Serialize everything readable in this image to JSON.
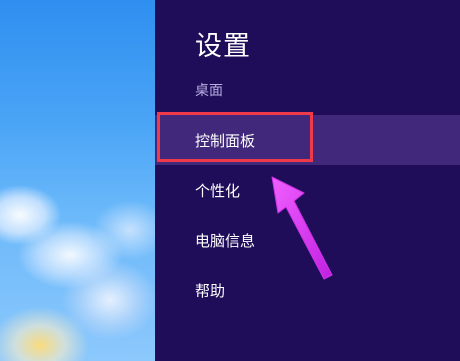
{
  "settings": {
    "title": "设置",
    "subtitle": "桌面",
    "items": [
      {
        "label": "控制面板",
        "selected": true
      },
      {
        "label": "个性化",
        "selected": false
      },
      {
        "label": "电脑信息",
        "selected": false
      },
      {
        "label": "帮助",
        "selected": false
      }
    ]
  },
  "colors": {
    "panel_background": "#1f0d5a",
    "selected_item_background": "#41287a",
    "highlight_border": "#ee3a4a",
    "annotation_arrow": "#e040f0"
  }
}
